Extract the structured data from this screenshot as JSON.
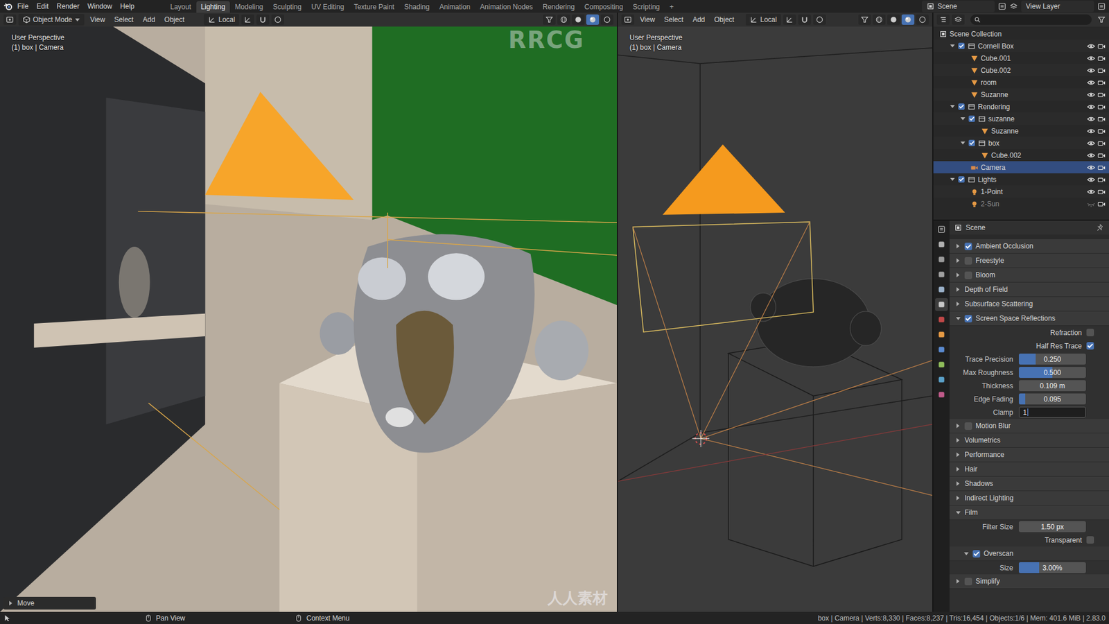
{
  "topbar": {
    "menus": [
      "File",
      "Edit",
      "Render",
      "Window",
      "Help"
    ],
    "workspaces": [
      {
        "label": "Layout",
        "selected": false
      },
      {
        "label": "Lighting",
        "selected": true
      },
      {
        "label": "Modeling",
        "selected": false
      },
      {
        "label": "Sculpting",
        "selected": false
      },
      {
        "label": "UV Editing",
        "selected": false
      },
      {
        "label": "Texture Paint",
        "selected": false
      },
      {
        "label": "Shading",
        "selected": false
      },
      {
        "label": "Animation",
        "selected": false
      },
      {
        "label": "Animation Nodes",
        "selected": false
      },
      {
        "label": "Rendering",
        "selected": false
      },
      {
        "label": "Compositing",
        "selected": false
      },
      {
        "label": "Scripting",
        "selected": false
      }
    ],
    "add_workspace": "+",
    "scene": "Scene",
    "view_layer": "View Layer"
  },
  "viewports": [
    {
      "mode": "Object Mode",
      "menus": [
        "View",
        "Select",
        "Add",
        "Object"
      ],
      "orientation": "Local",
      "overlay_title": "User Perspective",
      "overlay_object": "(1) box | Camera",
      "operator_panel": "Move"
    },
    {
      "menus": [
        "View",
        "Select",
        "Add",
        "Object"
      ],
      "orientation": "Local",
      "overlay_title": "User Perspective",
      "overlay_object": "(1) box | Camera"
    }
  ],
  "outliner": {
    "items": [
      {
        "label": "Scene Collection",
        "kind": "scene",
        "depth": 0,
        "hidden": false,
        "selected": false
      },
      {
        "label": "Cornell Box",
        "kind": "collection",
        "depth": 1,
        "expanded": true,
        "checked": true,
        "hidden": false,
        "selected": false
      },
      {
        "label": "Cube.001",
        "kind": "mesh",
        "depth": 2,
        "hidden": false,
        "selected": false
      },
      {
        "label": "Cube.002",
        "kind": "mesh",
        "depth": 2,
        "hidden": false,
        "selected": false
      },
      {
        "label": "room",
        "kind": "mesh",
        "depth": 2,
        "hidden": false,
        "selected": false
      },
      {
        "label": "Suzanne",
        "kind": "mesh",
        "depth": 2,
        "hidden": false,
        "selected": false
      },
      {
        "label": "Rendering",
        "kind": "collection",
        "depth": 1,
        "expanded": true,
        "checked": true,
        "hidden": false,
        "selected": false
      },
      {
        "label": "suzanne",
        "kind": "collection",
        "depth": 2,
        "expanded": true,
        "checked": true,
        "hidden": false,
        "selected": false
      },
      {
        "label": "Suzanne",
        "kind": "mesh",
        "depth": 3,
        "hidden": false,
        "selected": false
      },
      {
        "label": "box",
        "kind": "collection",
        "depth": 2,
        "expanded": true,
        "checked": true,
        "hidden": false,
        "selected": false
      },
      {
        "label": "Cube.002",
        "kind": "mesh",
        "depth": 3,
        "hidden": false,
        "selected": false
      },
      {
        "label": "Camera",
        "kind": "camera",
        "depth": 2,
        "hidden": false,
        "selected": true
      },
      {
        "label": "Lights",
        "kind": "collection",
        "depth": 1,
        "expanded": true,
        "checked": true,
        "hidden": false,
        "selected": false
      },
      {
        "label": "1-Point",
        "kind": "light",
        "depth": 2,
        "hidden": false,
        "selected": false
      },
      {
        "label": "2-Sun",
        "kind": "light",
        "depth": 2,
        "hidden": true,
        "selected": false
      }
    ]
  },
  "properties": {
    "context": "Scene",
    "tabs": [
      {
        "selected": false
      },
      {
        "selected": false
      },
      {
        "selected": false
      },
      {
        "selected": false
      },
      {
        "selected": true
      },
      {
        "selected": false
      },
      {
        "selected": false
      },
      {
        "selected": false
      },
      {
        "selected": false
      },
      {
        "selected": false
      },
      {
        "selected": false
      }
    ],
    "sections": [
      {
        "label": "Ambient Occlusion",
        "kind": "toggle",
        "checked": true,
        "expanded": false
      },
      {
        "label": "Freestyle",
        "kind": "toggle",
        "checked": false,
        "expanded": false
      },
      {
        "label": "Bloom",
        "kind": "toggle",
        "checked": false,
        "expanded": false
      },
      {
        "label": "Depth of Field",
        "kind": "plain",
        "expanded": false
      },
      {
        "label": "Subsurface Scattering",
        "kind": "plain",
        "expanded": false
      },
      {
        "label": "Screen Space Reflections",
        "kind": "toggle",
        "checked": true,
        "expanded": true,
        "rows": [
          {
            "kind": "checkbox",
            "label": "Refraction",
            "checked": false
          },
          {
            "kind": "checkbox",
            "label": "Half Res Trace",
            "checked": true
          },
          {
            "kind": "slider",
            "label": "Trace Precision",
            "value": "0.250",
            "level": 0.25
          },
          {
            "kind": "slider",
            "label": "Max Roughness",
            "value": "0.500",
            "level": 0.5
          },
          {
            "kind": "field",
            "label": "Thickness",
            "value": "0.109 m"
          },
          {
            "kind": "slider",
            "label": "Edge Fading",
            "value": "0.095",
            "level": 0.095
          },
          {
            "kind": "editing",
            "label": "Clamp",
            "value": "1"
          }
        ]
      },
      {
        "label": "Motion Blur",
        "kind": "toggle",
        "checked": false,
        "expanded": false
      },
      {
        "label": "Volumetrics",
        "kind": "plain",
        "expanded": false
      },
      {
        "label": "Performance",
        "kind": "plain",
        "expanded": false
      },
      {
        "label": "Hair",
        "kind": "plain",
        "expanded": false
      },
      {
        "label": "Shadows",
        "kind": "plain",
        "expanded": false
      },
      {
        "label": "Indirect Lighting",
        "kind": "plain",
        "expanded": false
      },
      {
        "label": "Film",
        "kind": "plain",
        "expanded": true,
        "rows": [
          {
            "kind": "field",
            "label": "Filter Size",
            "value": "1.50 px"
          },
          {
            "kind": "checkbox",
            "label": "Transparent",
            "checked": false
          }
        ],
        "subpanels": [
          {
            "label": "Overscan",
            "kind": "toggle",
            "checked": true,
            "expanded": true,
            "rows": [
              {
                "kind": "slider",
                "label": "Size",
                "value": "3.00%",
                "level": 0.3
              }
            ]
          }
        ]
      },
      {
        "label": "Simplify",
        "kind": "toggle",
        "checked": false,
        "expanded": false
      }
    ]
  },
  "status_bar": {
    "hints": [
      "Pan View",
      "Context Menu"
    ],
    "stats": "box | Camera | Verts:8,330 | Faces:8,237 | Tris:16,454 | Objects:1/6 | Mem: 401.6 MiB | 2.83.0"
  },
  "watermarks": [
    "RRCG",
    "人人素材"
  ]
}
